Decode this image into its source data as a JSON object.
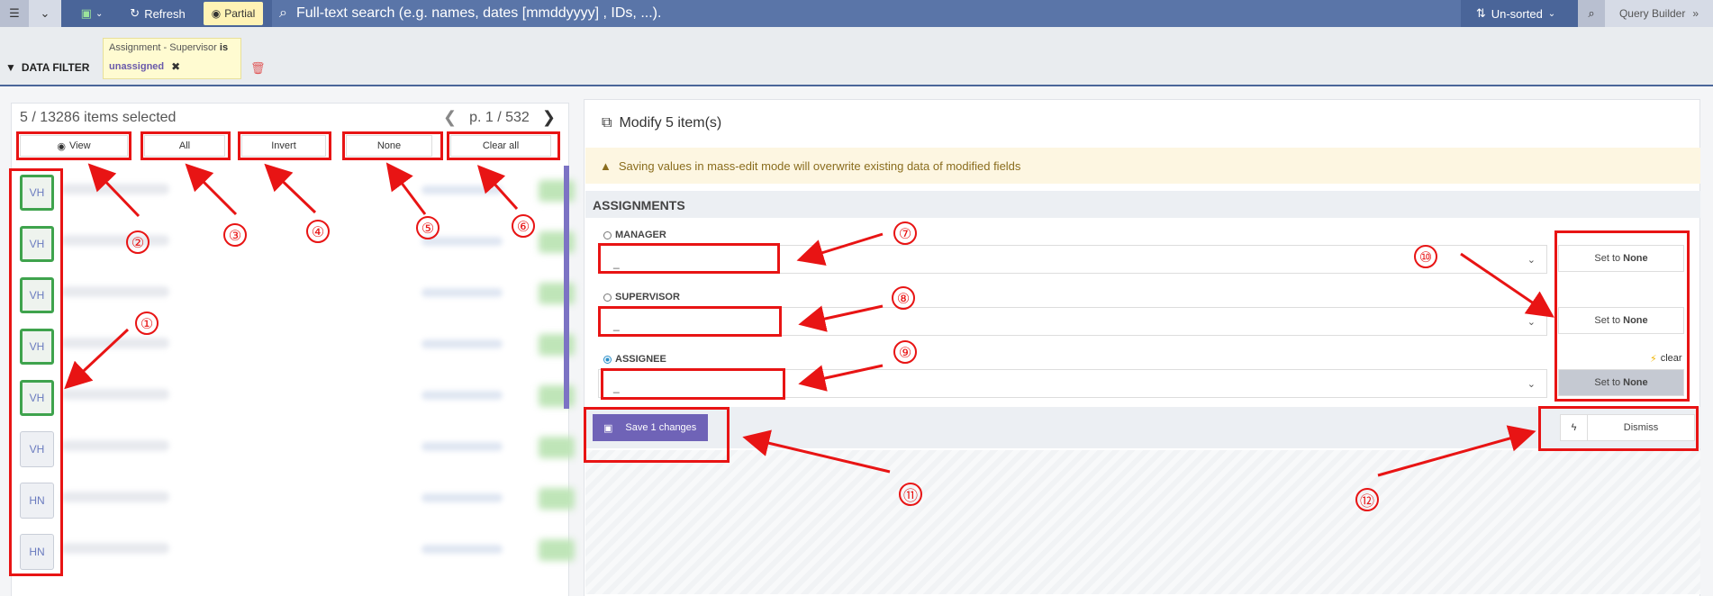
{
  "topbar": {
    "menu_icon": "☰",
    "caret_icon": "⌄",
    "save_icon": "💾",
    "refresh_label": "Refresh",
    "partial_label": "Partial",
    "search_placeholder": "Full-text search (e.g. names, dates [mmddyyyy] , IDs, ...).",
    "sort_label": "Un-sorted",
    "query_builder_label": "Query Builder"
  },
  "filter": {
    "label": "DATA FILTER",
    "chip_field": "Assignment - Supervisor",
    "chip_op": "is",
    "chip_value": "unassigned"
  },
  "list": {
    "selection_text": "5 / 13286 items selected",
    "page_text": "p. 1 / 532",
    "buttons": {
      "view": "View",
      "all": "All",
      "invert": "Invert",
      "none": "None",
      "clear_all": "Clear all"
    },
    "items": [
      {
        "initials": "VH",
        "selected": true
      },
      {
        "initials": "VH",
        "selected": true
      },
      {
        "initials": "VH",
        "selected": true
      },
      {
        "initials": "VH",
        "selected": true
      },
      {
        "initials": "VH",
        "selected": true
      },
      {
        "initials": "VH",
        "selected": false
      },
      {
        "initials": "HN",
        "selected": false
      },
      {
        "initials": "HN",
        "selected": false
      }
    ]
  },
  "modify": {
    "title": "Modify 5 item(s)",
    "warning": "Saving values in mass-edit mode will overwrite existing data of modified fields",
    "section": "ASSIGNMENTS",
    "fields": [
      {
        "label": "MANAGER",
        "value": "_",
        "set_none_prefix": "Set to",
        "set_none_bold": "None",
        "checked": false
      },
      {
        "label": "SUPERVISOR",
        "value": "_",
        "set_none_prefix": "Set to",
        "set_none_bold": "None",
        "checked": false
      },
      {
        "label": "ASSIGNEE",
        "value": "_",
        "set_none_prefix": "Set to",
        "set_none_bold": "None",
        "checked": true
      }
    ],
    "clear_label": "clear",
    "save_label": "Save 1 changes",
    "dismiss_label": "Dismiss"
  },
  "annotations": [
    "①",
    "②",
    "③",
    "④",
    "⑤",
    "⑥",
    "⑦",
    "⑧",
    "⑨",
    "⑩",
    "⑪",
    "⑫"
  ],
  "colors": {
    "topbar": "#4a6599",
    "accent_purple": "#6f63b7",
    "selected_green": "#3fa34d",
    "annotation_red": "#e81414"
  }
}
